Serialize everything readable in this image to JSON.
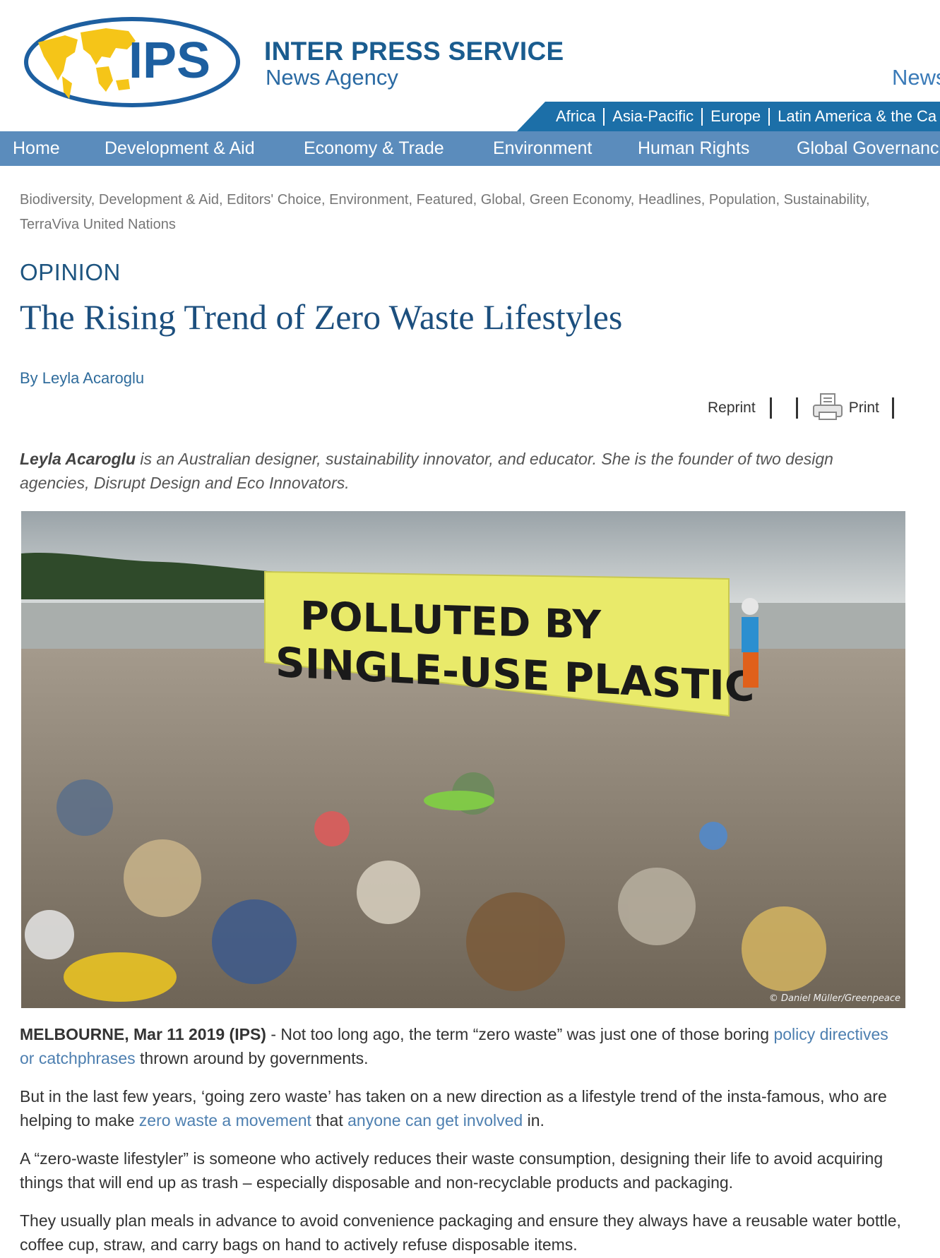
{
  "header": {
    "logo_text": "IPS",
    "brand_name": "INTER PRESS SERVICE",
    "brand_sub": "News Agency",
    "right_text": "News",
    "regions": [
      "Africa",
      "Asia-Pacific",
      "Europe",
      "Latin America & the Ca"
    ]
  },
  "nav": {
    "items": [
      "Home",
      "Development & Aid",
      "Economy & Trade",
      "Environment",
      "Human Rights",
      "Global Governanc"
    ]
  },
  "categories": [
    "Biodiversity",
    "Development & Aid",
    "Editors' Choice",
    "Environment",
    "Featured",
    "Global",
    "Green Economy",
    "Headlines",
    "Population",
    "Sustainability",
    "TerraViva United Nations"
  ],
  "article": {
    "kicker": "OPINION",
    "title": "The Rising Trend of Zero Waste Lifestyles",
    "byline": "By Leyla Acaroglu",
    "tools": {
      "reprint": "Reprint",
      "print": "Print"
    },
    "bio_name": "Leyla Acaroglu",
    "bio_rest": " is an Australian designer, sustainability innovator, and educator. She is the founder of two design agencies, Disrupt Design and Eco Innovators.",
    "image": {
      "banner_line1": "POLLUTED BY",
      "banner_line2": "SINGLE-USE PLASTIC",
      "credit": "© Daniel Müller/Greenpeace"
    },
    "p1": {
      "dateline": "MELBOURNE, Mar 11 2019 (IPS)",
      "t1": " - Not too long ago, the term “zero waste” was just one of those boring ",
      "link1": "policy directives or catchphrases",
      "t2": " thrown around by governments."
    },
    "p2": {
      "t1": "But in the last few years, ‘going zero waste’ has taken on a new direction as a lifestyle trend of the insta-famous, who are helping to make ",
      "link1": "zero waste a movement",
      "t2": " that ",
      "link2": "anyone can get involved",
      "t3": " in."
    },
    "p3": "A “zero-waste lifestyler” is someone who actively reduces their waste consumption, designing their life to avoid acquiring things that will end up as trash – especially disposable and non-recyclable products and packaging.",
    "p4": "They usually plan meals in advance to avoid convenience packaging and ensure they always have a reusable water bottle, coffee cup, straw, and carry bags on hand to actively refuse disposable items."
  },
  "colors": {
    "brand_blue": "#1a5c8f",
    "nav_bg": "#5b8cbc",
    "region_bg": "#1c6fa8",
    "headline": "#1c4f7e",
    "link": "#4d7fb0",
    "logo_yellow": "#f5c518"
  }
}
